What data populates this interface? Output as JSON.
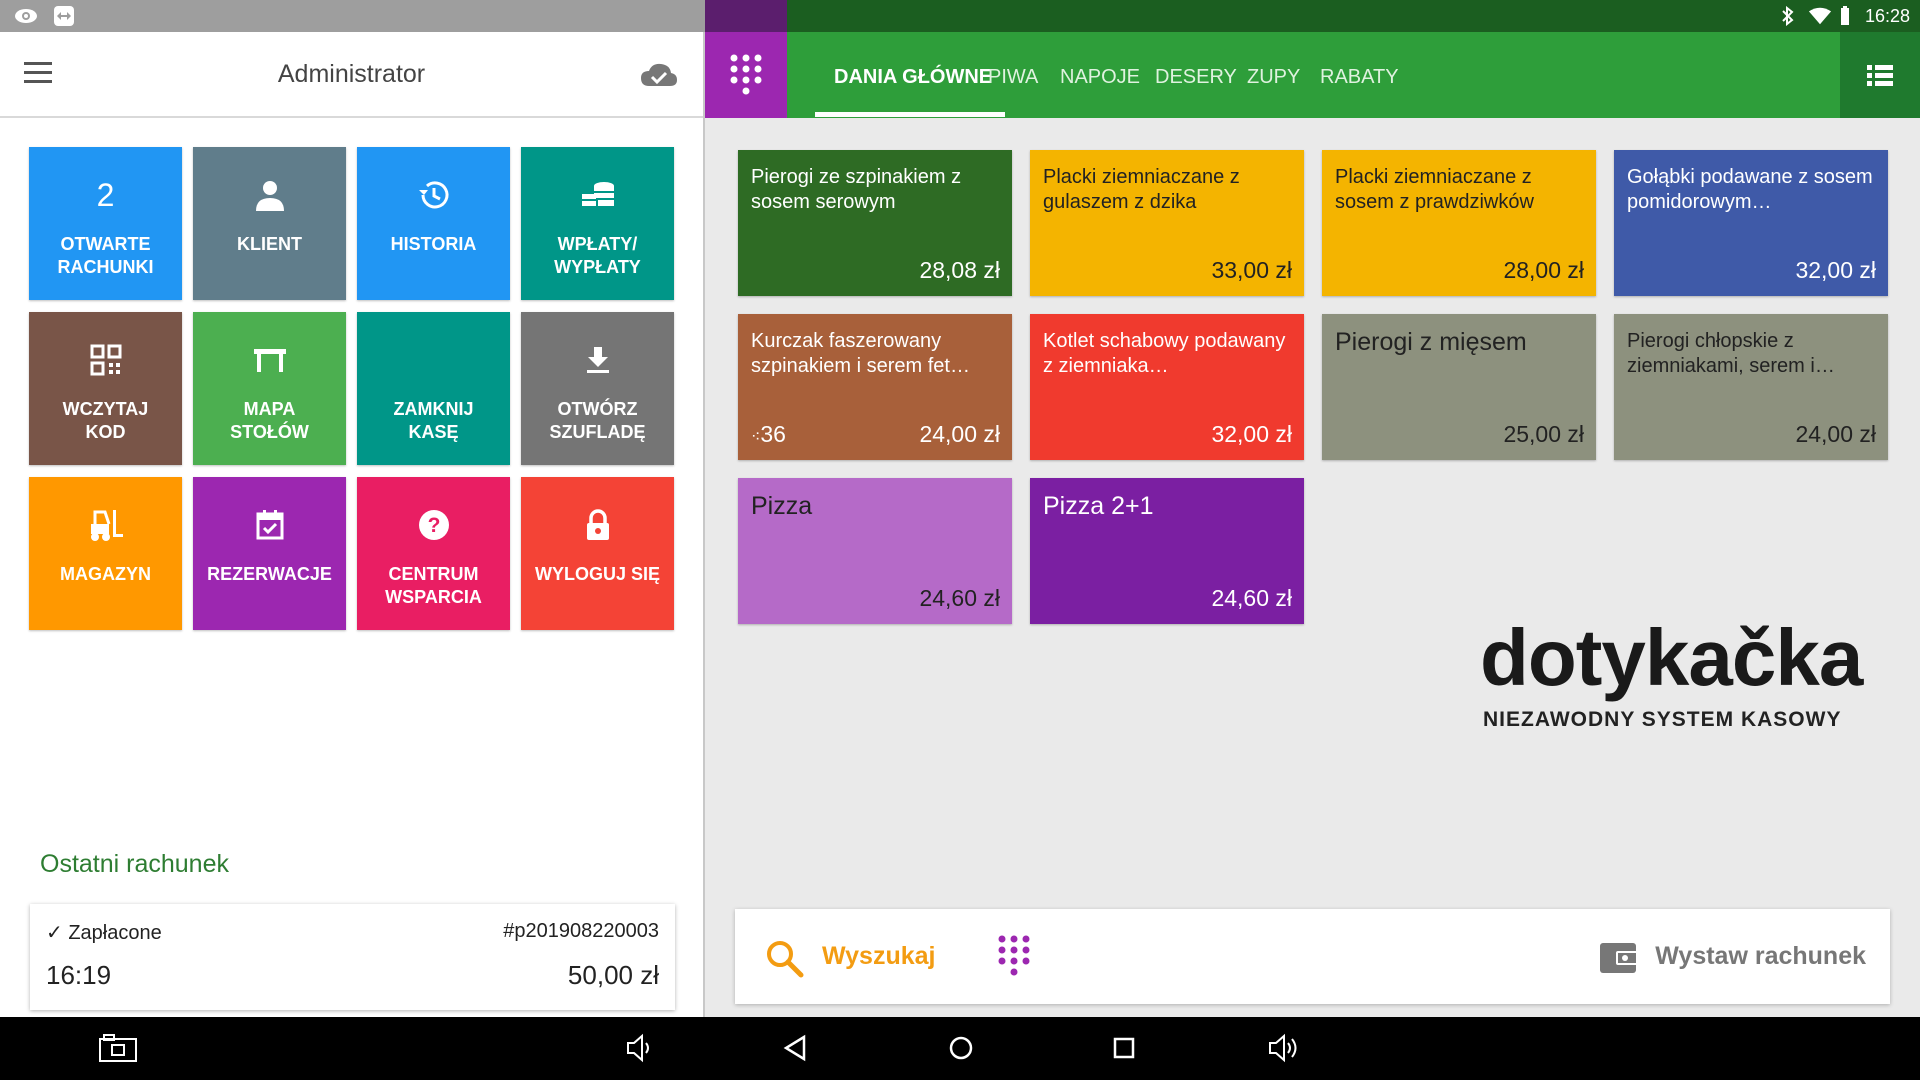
{
  "status_bar": {
    "time": "16:28",
    "icons": [
      "eye-icon",
      "teamviewer-icon",
      "bluetooth-icon",
      "wifi-icon",
      "battery-icon"
    ]
  },
  "left_panel": {
    "title": "Administrator",
    "tiles": [
      {
        "label": "OTWARTE\nRACHUNKI",
        "value": "2",
        "icon": "count-number",
        "color": "#2196f3"
      },
      {
        "label": "KLIENT",
        "icon": "person-icon",
        "color": "#607d8b"
      },
      {
        "label": "HISTORIA",
        "icon": "history-icon",
        "color": "#2196f3"
      },
      {
        "label": "WPŁATY/\nWYPŁATY",
        "icon": "coins-icon",
        "color": "#009688"
      },
      {
        "label": "WCZYTAJ\nKOD",
        "icon": "qr-code-icon",
        "color": "#795548"
      },
      {
        "label": "MAPA\nSTOŁÓW",
        "icon": "table-icon",
        "color": "#4caf50"
      },
      {
        "label": "ZAMKNIJ\nKASĘ",
        "icon": "",
        "color": "#009688"
      },
      {
        "label": "OTWÓRZ\nSZUFLADĘ",
        "icon": "download-icon",
        "color": "#757575"
      },
      {
        "label": "MAGAZYN",
        "icon": "forklift-icon",
        "color": "#ff9800"
      },
      {
        "label": "REZERWACJE",
        "icon": "calendar-check-icon",
        "color": "#9c27b0"
      },
      {
        "label": "CENTRUM\nWSPARCIA",
        "icon": "help-icon",
        "color": "#e91e63"
      },
      {
        "label": "WYLOGUJ SIĘ",
        "icon": "lock-icon",
        "color": "#f44336"
      }
    ],
    "last_bill": {
      "heading": "Ostatni rachunek",
      "status": "Zapłacone",
      "number": "#p201908220003",
      "time": "16:19",
      "amount": "50,00 zł"
    }
  },
  "right_panel": {
    "tabs": [
      "DANIA GŁÓWNE",
      "PIWA",
      "NAPOJE",
      "DESERY",
      "ZUPY",
      "RABATY"
    ],
    "active_tab": "DANIA GŁÓWNE",
    "products": [
      {
        "name": "Pierogi ze szpinakiem z sosem serowym",
        "price": "28,08 zł",
        "color": "#2e6b24"
      },
      {
        "name": "Placki ziemniaczane z gulaszem z dzika",
        "price": "33,00 zł",
        "color": "#f4b400"
      },
      {
        "name": "Placki ziemniaczane z sosem z prawdziwków",
        "price": "28,00 zł",
        "color": "#f4b400"
      },
      {
        "name": "Gołąbki podawane z sosem pomidorowym…",
        "price": "32,00 zł",
        "color": "#3f5aa8"
      },
      {
        "name": "Kurczak faszerowany szpinakiem i serem fet…",
        "price": "24,00 zł",
        "stock": "36",
        "color": "#a8603a"
      },
      {
        "name": "Kotlet schabowy podawany z ziemniaka…",
        "price": "32,00 zł",
        "color": "#f03a2e"
      },
      {
        "name": "Pierogi z mięsem",
        "price": "25,00 zł",
        "color": "#8d917e"
      },
      {
        "name": "Pierogi chłopskie z ziemniakami, serem i…",
        "price": "24,00 zł",
        "color": "#8d917e"
      },
      {
        "name": "Pizza",
        "price": "24,60 zł",
        "color": "#b56ac8"
      },
      {
        "name": "Pizza 2+1",
        "price": "24,60 zł",
        "color": "#7b1fa2"
      }
    ],
    "logo": {
      "word": "dotykačka",
      "tagline": "NIEZAWODNY SYSTEM KASOWY"
    },
    "bottom": {
      "search": "Wyszukaj",
      "invoice": "Wystaw rachunek"
    }
  },
  "colors": {
    "accent_green": "#2e9e3a",
    "accent_purple": "#9c27b0",
    "accent_orange": "#f39c12"
  }
}
